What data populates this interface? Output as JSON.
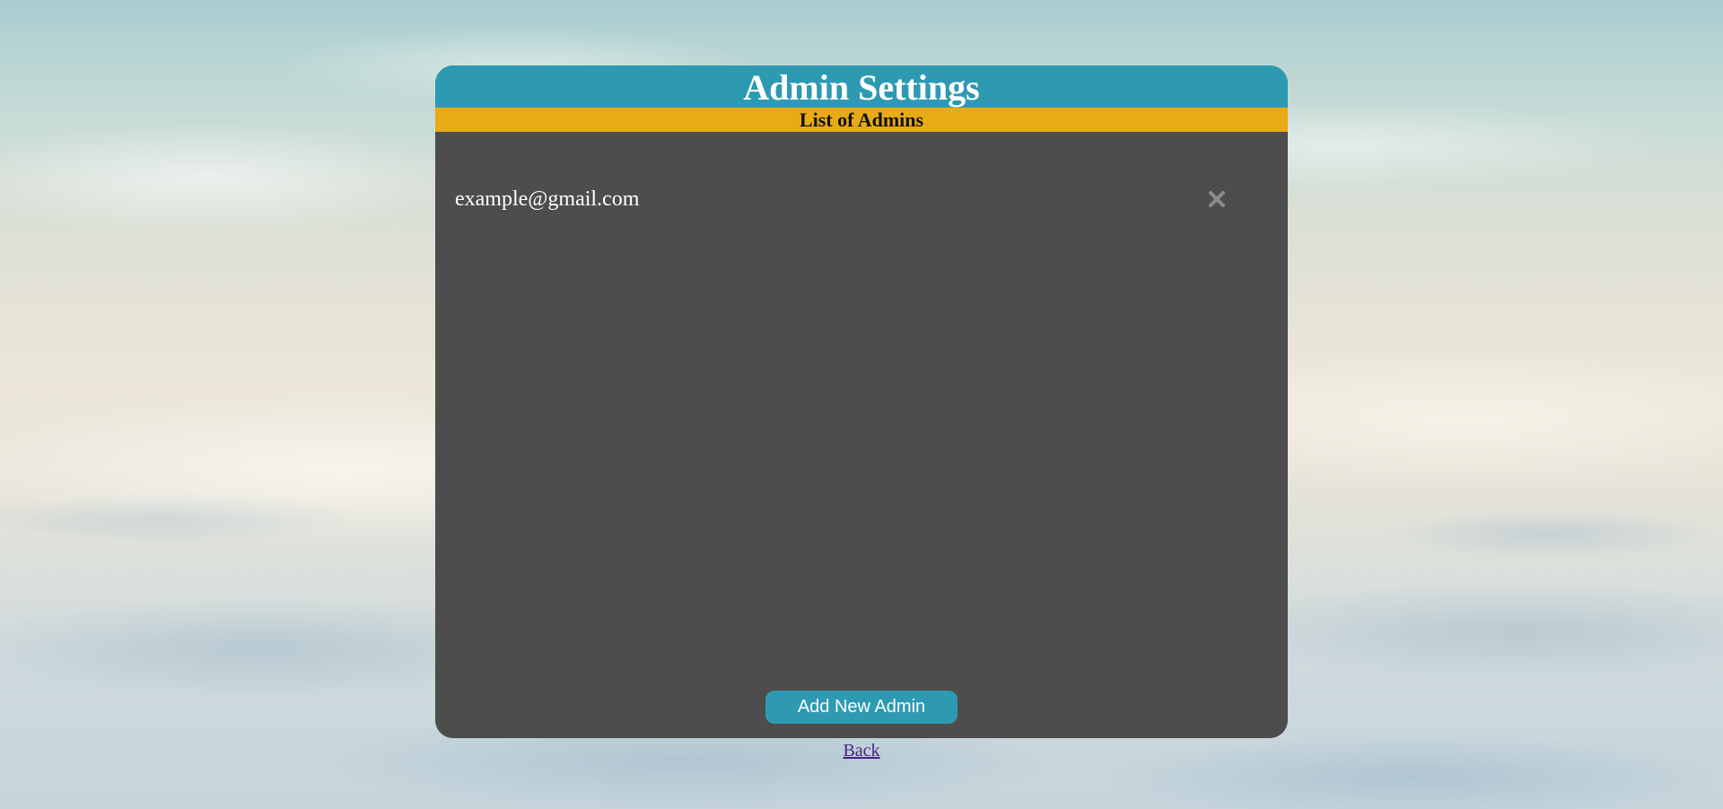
{
  "header": {
    "title": "Admin Settings",
    "subtitle": "List of Admins"
  },
  "admins": [
    {
      "email": "example@gmail.com",
      "remove_icon": "close-icon"
    }
  ],
  "actions": {
    "add_label": "Add New Admin",
    "back_label": "Back"
  },
  "colors": {
    "header_bg": "#2e9ab2",
    "subheader_bg": "#e8aa15",
    "panel_bg": "#4d4d4d",
    "button_bg": "#2e9ab2",
    "remove_icon": "#8a8a8a",
    "link": "#4b1f86"
  }
}
